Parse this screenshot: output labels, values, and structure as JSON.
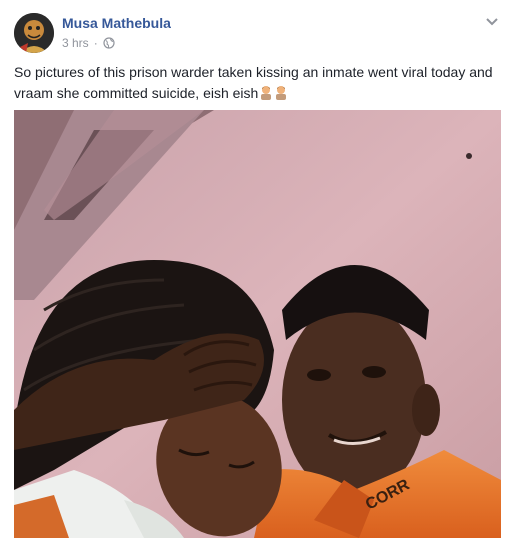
{
  "post": {
    "author": "Musa Mathebula",
    "time": "3 hrs",
    "separator": "·",
    "privacy_icon": "globe-icon",
    "menu_icon": "chevron-down-icon",
    "text": "So pictures of this prison warder taken kissing an inmate went viral today and vraam she committed suicide, eish eish",
    "emoji_icon": "man-facepalm-emoji"
  },
  "photo": {
    "shirt_text": "CORR"
  },
  "colors": {
    "author_link": "#365899",
    "meta_gray": "#90949c",
    "body_text": "#1d2129",
    "wall_pink": "#d9b0b6",
    "prison_orange": "#e8702a"
  }
}
